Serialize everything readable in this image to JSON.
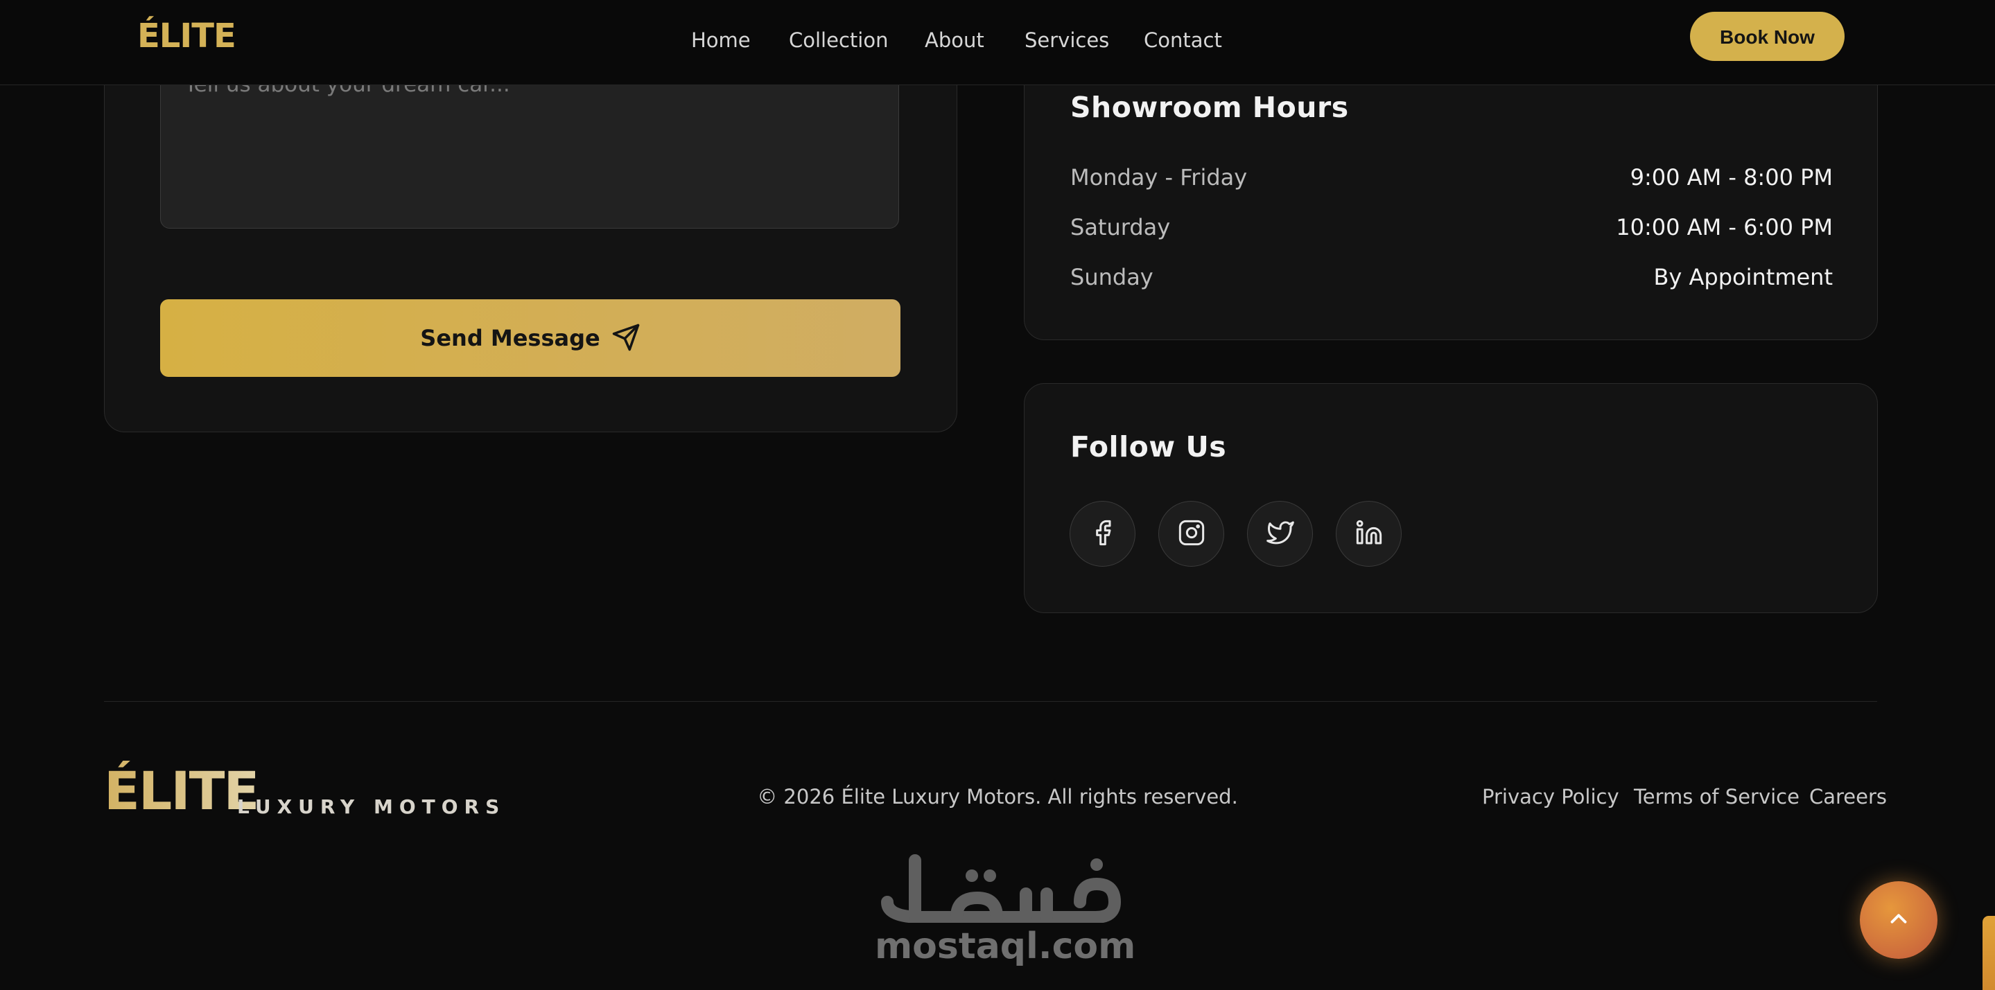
{
  "nav": {
    "logo": "ÉLITE",
    "links": [
      "Home",
      "Collection",
      "About",
      "Services",
      "Contact"
    ],
    "cta": "Book Now"
  },
  "contact_form": {
    "message_placeholder": "Tell us about your dream car...",
    "submit_label": "Send Message"
  },
  "hours": {
    "title": "Showroom Hours",
    "rows": [
      {
        "day": "Monday - Friday",
        "time": "9:00 AM - 8:00 PM"
      },
      {
        "day": "Saturday",
        "time": "10:00 AM - 6:00 PM"
      },
      {
        "day": "Sunday",
        "time": "By Appointment"
      }
    ]
  },
  "follow": {
    "title": "Follow Us",
    "icons": [
      "facebook-icon",
      "instagram-icon",
      "twitter-icon",
      "linkedin-icon"
    ]
  },
  "footer": {
    "logo_mark": "ÉLITE",
    "logo_sub": "LUXURY MOTORS",
    "copyright": "© 2026 Élite Luxury Motors. All rights reserved.",
    "links": [
      "Privacy Policy",
      "Terms of Service",
      "Careers"
    ]
  },
  "watermark": {
    "arabic": "مستقل",
    "latin": "mostaql.com"
  },
  "colors": {
    "accent_gold": "#d4b14c",
    "background": "#0b0b0b",
    "card": "#131313",
    "scroll_top": "#e6973c"
  }
}
